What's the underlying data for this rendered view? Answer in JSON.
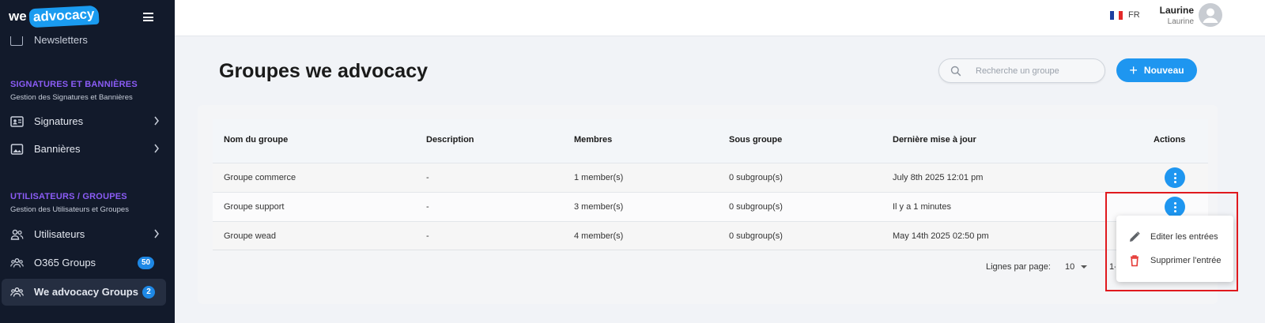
{
  "brand": {
    "logo_we": "we",
    "logo_advocacy": "advocacy"
  },
  "sidebar": {
    "cut_item": {
      "label": "Newsletters",
      "icon": "newsletter-icon"
    },
    "sections": [
      {
        "title": "SIGNATURES ET BANNIÈRES",
        "subtitle": "Gestion des Signatures et Bannières",
        "items": [
          {
            "label": "Signatures",
            "icon": "id-card-icon"
          },
          {
            "label": "Bannières",
            "icon": "image-icon"
          }
        ]
      },
      {
        "title": "UTILISATEURS / GROUPES",
        "subtitle": "Gestion des Utilisateurs et Groupes",
        "items": [
          {
            "label": "Utilisateurs",
            "icon": "users-icon"
          },
          {
            "label": "O365 Groups",
            "icon": "group-icon",
            "badge": "50"
          },
          {
            "label": "We advocacy Groups",
            "icon": "group-icon",
            "badge": "2"
          }
        ]
      }
    ],
    "accent_color": "#8b5cf6"
  },
  "topbar": {
    "lang": "FR",
    "user_name": "Laurine",
    "user_sub": "Laurine"
  },
  "main": {
    "title": "Groupes we advocacy",
    "search_placeholder": "Recherche un groupe",
    "new_button": "Nouveau",
    "accent_color": "#1e96f0"
  },
  "table": {
    "headers": [
      "Nom du groupe",
      "Description",
      "Membres",
      "Sous groupe",
      "Dernière mise à jour",
      "Actions"
    ],
    "rows": [
      {
        "name": "Groupe commerce",
        "description": "-",
        "members": "1 member(s)",
        "subgroups": "0 subgroup(s)",
        "updated": "July 8th 2025 12:01 pm"
      },
      {
        "name": "Groupe support",
        "description": "-",
        "members": "3 member(s)",
        "subgroups": "0 subgroup(s)",
        "updated": "Il y a 1 minutes"
      },
      {
        "name": "Groupe wead",
        "description": "-",
        "members": "4 member(s)",
        "subgroups": "0 subgroup(s)",
        "updated": "May 14th 2025 02:50 pm"
      }
    ]
  },
  "pagination": {
    "rows_per_page_label": "Lignes par page:",
    "rows_per_page_value": "10",
    "range": "1-"
  },
  "action_menu": {
    "items": [
      {
        "label": "Editer les entrées",
        "icon": "pencil-icon",
        "color": "#555555"
      },
      {
        "label": "Supprimer l'entrée",
        "icon": "trash-icon",
        "color": "#e53935"
      }
    ]
  },
  "highlight_color": "#e0191e"
}
